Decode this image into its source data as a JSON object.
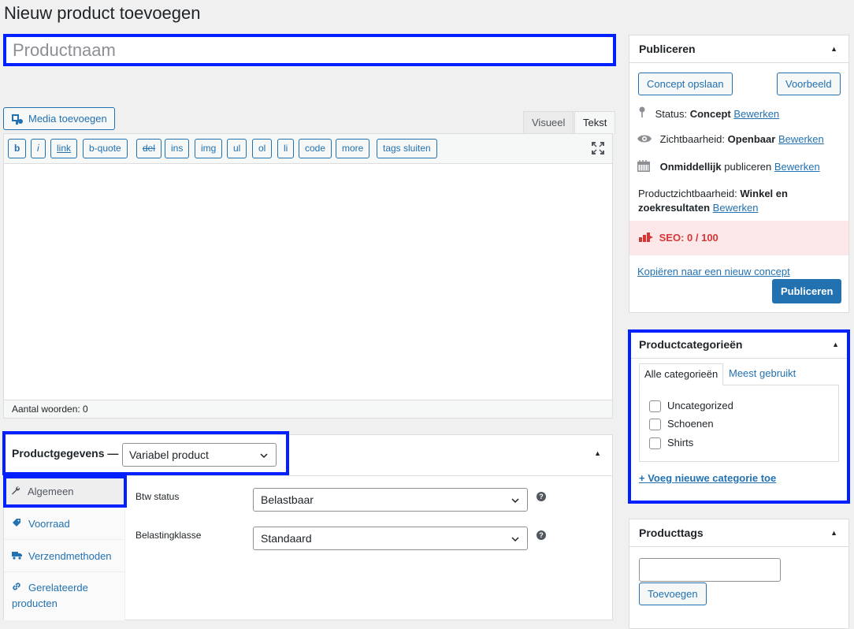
{
  "page": {
    "title": "Nieuw product toevoegen"
  },
  "title_field": {
    "placeholder": "Productnaam"
  },
  "editor": {
    "media_button": "Media toevoegen",
    "tabs": {
      "visual": "Visueel",
      "text": "Tekst"
    },
    "quicktags": [
      "b",
      "i",
      "link",
      "b-quote",
      "del",
      "ins",
      "img",
      "ul",
      "ol",
      "li",
      "code",
      "more",
      "tags sluiten"
    ],
    "word_count": "Aantal woorden: 0"
  },
  "product_data": {
    "title": "Productgegevens —",
    "type_selected": "Variabel product",
    "tabs": [
      {
        "label": "Algemeen",
        "icon": "wrench-icon"
      },
      {
        "label": "Voorraad",
        "icon": "tag-icon"
      },
      {
        "label": "Verzendmethoden",
        "icon": "truck-icon"
      },
      {
        "label": "Gerelateerde producten",
        "icon": "link-icon"
      }
    ],
    "fields": [
      {
        "label": "Btw status",
        "value": "Belastbaar"
      },
      {
        "label": "Belastingklasse",
        "value": "Standaard"
      }
    ]
  },
  "publish": {
    "title": "Publiceren",
    "save_draft": "Concept opslaan",
    "preview": "Voorbeeld",
    "status_label": "Status:",
    "status_value": "Concept",
    "visibility_label": "Zichtbaarheid:",
    "visibility_value": "Openbaar",
    "schedule_value": "Onmiddellijk",
    "schedule_label": "publiceren",
    "catalog_label": "Productzichtbaarheid:",
    "catalog_value_1": "Winkel en",
    "catalog_value_2": "zoekresultaten",
    "edit_link": "Bewerken",
    "seo": "SEO: 0 / 100",
    "copy_link": "Kopiëren naar een nieuw concept",
    "publish_button": "Publiceren"
  },
  "categories": {
    "title": "Productcategorieën",
    "tab_all": "Alle categorieën",
    "tab_popular": "Meest gebruikt",
    "items": [
      "Uncategorized",
      "Schoenen",
      "Shirts"
    ],
    "add_link": "+ Voeg nieuwe categorie toe"
  },
  "tags": {
    "title": "Producttags",
    "add_button": "Toevoegen"
  },
  "colors": {
    "highlight": "#0020ff",
    "link": "#2271b1",
    "seo_red": "#d63638"
  }
}
